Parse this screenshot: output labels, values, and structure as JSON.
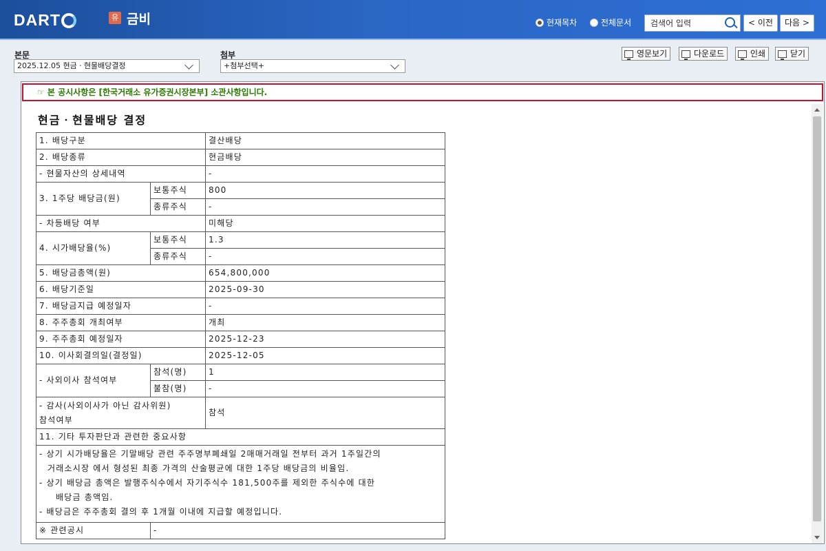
{
  "header": {
    "logo_text": "DART",
    "report_badge": "유",
    "company_name": "금비",
    "radio_current": "현재목차",
    "radio_all": "전체문서",
    "search_placeholder": "검색어 입력",
    "prev_label": "< 이전",
    "next_label": "다음 >"
  },
  "selectors": {
    "main_label": "본문",
    "main_value": "2025.12.05  현금ㆍ현물배당결정",
    "attach_label": "첨부",
    "attach_value": "+첨부선택+"
  },
  "toolbar": {
    "english_view": "영문보기",
    "download": "다운로드",
    "print": "인쇄",
    "close": "닫기"
  },
  "notice": "☞ 본 공시사항은 [한국거래소 유가증권시장본부] 소관사항입니다.",
  "document": {
    "title": "현금ㆍ현물배당 결정",
    "rows": {
      "r1_label": "1. 배당구분",
      "r1_value": "결산배당",
      "r2_label": "2. 배당종류",
      "r2_value": "현금배당",
      "r3_label": "- 현물자산의 상세내역",
      "r3_value": "-",
      "r4_label": "3. 1주당 배당금(원)",
      "r4_sub1": "보통주식",
      "r4_val1": "800",
      "r4_sub2": "종류주식",
      "r4_val2": "-",
      "r5_label": "- 차등배당 여부",
      "r5_value": "미해당",
      "r6_label": "4. 시가배당율(%)",
      "r6_sub1": "보통주식",
      "r6_val1": "1.3",
      "r6_sub2": "종류주식",
      "r6_val2": "-",
      "r7_label": "5. 배당금총액(원)",
      "r7_value": "654,800,000",
      "r8_label": "6. 배당기준일",
      "r8_value": "2025-09-30",
      "r9_label": "7. 배당금지급 예정일자",
      "r9_value": "-",
      "r10_label": "8. 주주총회 개최여부",
      "r10_value": "개최",
      "r11_label": "9. 주주총회 예정일자",
      "r11_value": "2025-12-23",
      "r12_label": "10. 이사회결의일(결정일)",
      "r12_value": "2025-12-05",
      "r13_label": "- 사외이사 참석여부",
      "r13_sub1": "참석(명)",
      "r13_val1": "1",
      "r13_sub2": "불참(명)",
      "r13_val2": "-",
      "r14_label_line1": "- 감사(사외이사가 아닌 감사위원)",
      "r14_label_line2": "참석여부",
      "r14_value": "참석",
      "r15_label": "11. 기타 투자판단과 관련한 중요사항",
      "note_lines": {
        "l1": "- 상기 시가배당율은 기말배당 관련 주주명부폐쇄일 2매매거래일 전부터 과거 1주일간의",
        "l2": "거래소시장 에서 형성된 최종 가격의 산술평균에 대한 1주당 배당금의 비율임.",
        "l3": "- 상기 배당금 총액은 발행주식수에서 자기주식수 181,500주를 제외한 주식수에 대한",
        "l4": "배당금 총액임.",
        "l5": "- 배당금은 주주총회 결의 후 1개월 이내에 지급할 예정입니다."
      },
      "r16_label": "※ 관련공시",
      "r16_value": "-"
    }
  }
}
